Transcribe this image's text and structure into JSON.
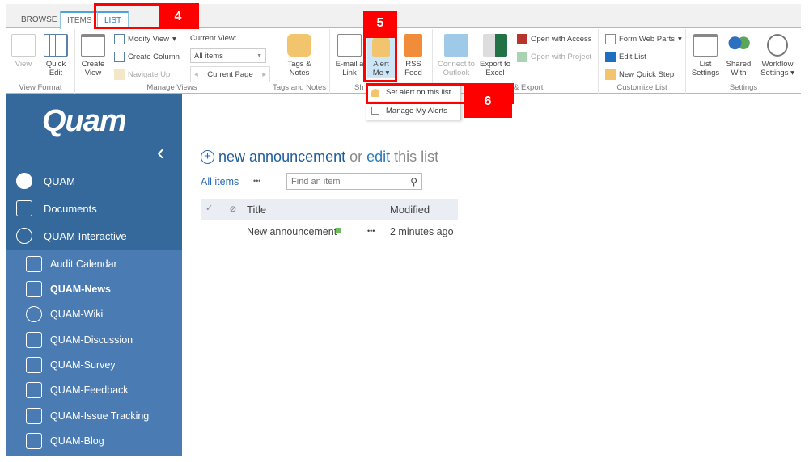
{
  "tabs": [
    {
      "label": "BROWSE"
    },
    {
      "label": "ITEMS"
    },
    {
      "label": "LIST"
    }
  ],
  "ribbon": {
    "view_format": {
      "label": "View Format",
      "view": "View",
      "quick_edit": "Quick Edit"
    },
    "manage_views": {
      "label": "Manage Views",
      "create_view": "Create View",
      "modify_view": "Modify View",
      "create_column": "Create Column",
      "navigate_up": "Navigate Up",
      "current_view_label": "Current View:",
      "current_view_value": "All items",
      "current_page": "Current Page"
    },
    "tags_notes": {
      "label": "Tags and Notes",
      "button": "Tags & Notes"
    },
    "share": {
      "label": "Sh",
      "email": "E-mail a Link",
      "alert": "Alert Me",
      "rss": "RSS Feed"
    },
    "connect": {
      "label": "& Export",
      "outlook": "Connect to Outlook",
      "excel": "Export to Excel",
      "access": "Open with Access",
      "project": "Open with Project"
    },
    "customize": {
      "label": "Customize List",
      "form_web_parts": "Form Web Parts",
      "edit_list": "Edit List",
      "quick_step": "New Quick Step"
    },
    "settings": {
      "label": "Settings",
      "list_settings": "List Settings",
      "shared_with": "Shared With",
      "workflow": "Workflow Settings"
    }
  },
  "alert_menu": {
    "items": [
      {
        "label": "Set alert on this list"
      },
      {
        "label": "Manage My Alerts"
      }
    ]
  },
  "callouts": {
    "c4": "4",
    "c5": "5",
    "c6": "6"
  },
  "sidebar": {
    "logo": "Quam",
    "items": [
      {
        "label": "QUAM"
      },
      {
        "label": "Documents"
      },
      {
        "label": "QUAM Interactive"
      }
    ],
    "sub_items": [
      {
        "label": "Audit Calendar"
      },
      {
        "label": "QUAM-News"
      },
      {
        "label": "QUAM-Wiki"
      },
      {
        "label": "QUAM-Discussion"
      },
      {
        "label": "QUAM-Survey"
      },
      {
        "label": "QUAM-Feedback"
      },
      {
        "label": "QUAM-Issue Tracking"
      },
      {
        "label": "QUAM-Blog"
      }
    ]
  },
  "main": {
    "new_link": "new announcement",
    "or": "or",
    "edit": "edit",
    "this_list": "this list",
    "view_all": "All items",
    "ellipsis": "•••",
    "search_placeholder": "Find an item",
    "columns": {
      "title": "Title",
      "modified": "Modified"
    },
    "rows": [
      {
        "title": "New announcement",
        "modified": "2 minutes ago"
      }
    ]
  },
  "colors": {
    "sidebar": "#35689b",
    "subnav": "#4a7bb3",
    "accent": "#2a7ab9",
    "callout": "#ff0000"
  }
}
